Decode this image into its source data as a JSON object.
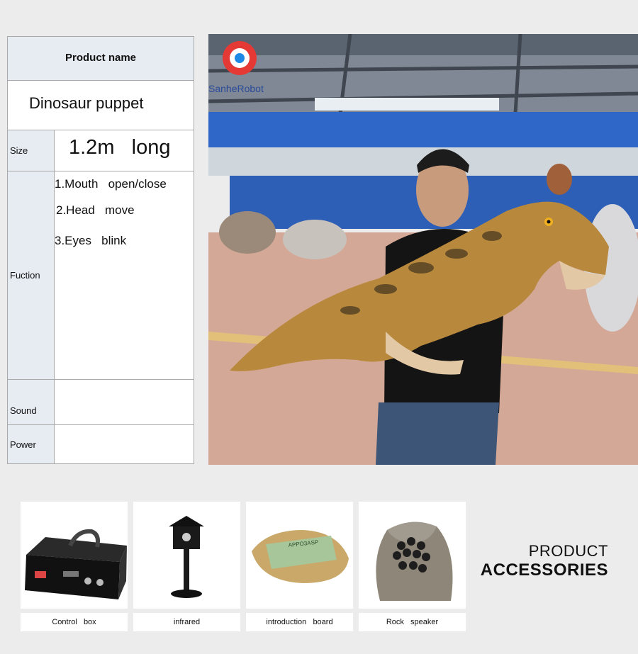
{
  "spec_table": {
    "header": "Product  name",
    "product_name": "Dinosaur puppet",
    "size_label": "Size",
    "size_value": "1.2m   long",
    "function_label": "Fuction",
    "functions": [
      "1.Mouth   open/close",
      "2.Head   move",
      "3.Eyes   blink"
    ],
    "sound_label": "Sound",
    "sound_value": "",
    "power_label": "Power",
    "power_value": ""
  },
  "photo": {
    "logo_text": "SanheRobot"
  },
  "accessories": {
    "title_line1": "PRODUCT",
    "title_line2": "ACCESSORIES",
    "items": [
      {
        "label": "Control   box",
        "icon": "control-box"
      },
      {
        "label": "infrared",
        "icon": "infrared-sensor"
      },
      {
        "label": "introduction   board",
        "icon": "introduction-board",
        "board_text": "APPO3ASP"
      },
      {
        "label": "Rock   speaker",
        "icon": "rock-speaker"
      }
    ]
  }
}
